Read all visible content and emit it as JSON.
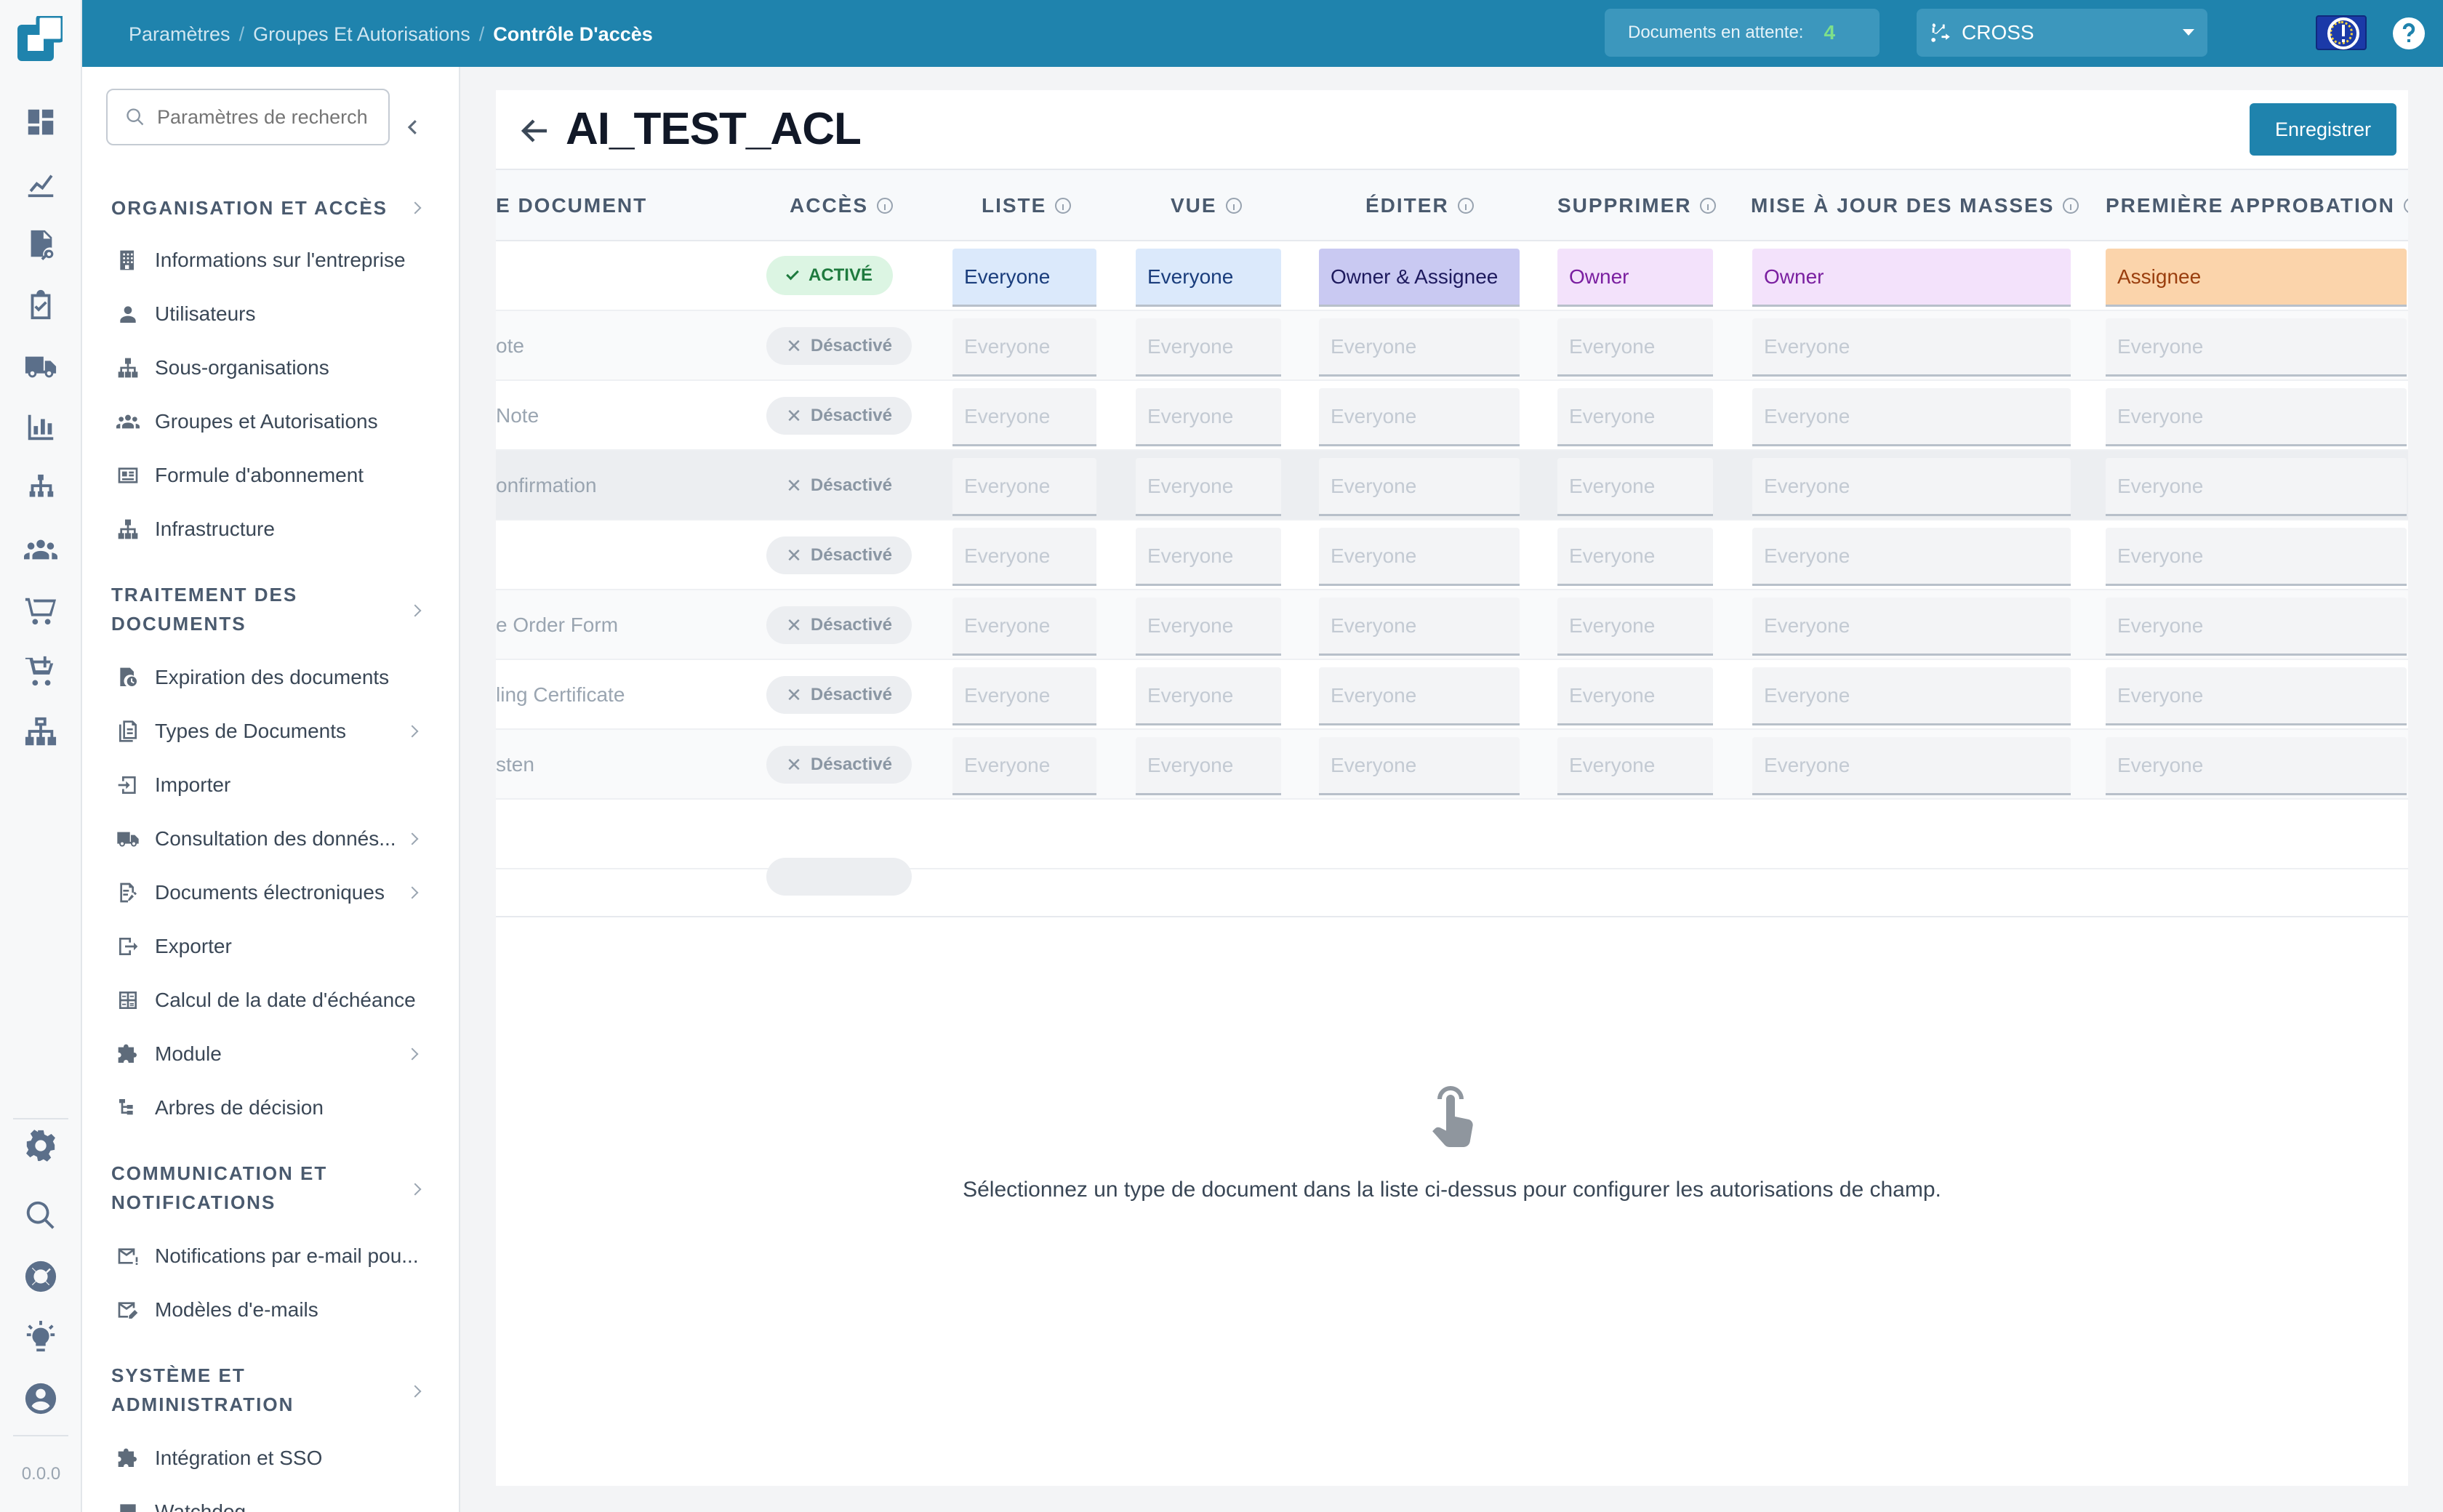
{
  "app": {
    "version": "0.0.0"
  },
  "breadcrumb": [
    "Paramètres",
    "Groupes Et Autorisations",
    "Contrôle D'accès"
  ],
  "header": {
    "pending_label": "Documents en attente:",
    "pending_count": "4",
    "org_select": "CROSS"
  },
  "sidebar": {
    "search_placeholder": "Paramètres de recherche",
    "sections": [
      {
        "title": "ORGANISATION ET ACCÈS",
        "items": [
          {
            "label": "Informations sur l'entreprise",
            "icon": "building-icon"
          },
          {
            "label": "Utilisateurs",
            "icon": "user-icon"
          },
          {
            "label": "Sous-organisations",
            "icon": "hierarchy-icon"
          },
          {
            "label": "Groupes et Autorisations",
            "icon": "group-icon"
          },
          {
            "label": "Formule d'abonnement",
            "icon": "card-icon"
          },
          {
            "label": "Infrastructure",
            "icon": "hierarchy-icon"
          }
        ]
      },
      {
        "title": "TRAITEMENT DES DOCUMENTS",
        "items": [
          {
            "label": "Expiration des documents",
            "icon": "doc-clock-icon"
          },
          {
            "label": "Types de Documents",
            "icon": "docs-icon"
          },
          {
            "label": "Importer",
            "icon": "import-icon"
          },
          {
            "label": "Consultation des donnés...",
            "icon": "truck-icon"
          },
          {
            "label": "Documents électroniques",
            "icon": "edoc-icon"
          },
          {
            "label": "Exporter",
            "icon": "export-icon"
          },
          {
            "label": "Calcul de la date d'échéance",
            "icon": "calculator-icon"
          },
          {
            "label": "Module",
            "icon": "puzzle-icon"
          },
          {
            "label": "Arbres de décision",
            "icon": "tree-icon"
          }
        ]
      },
      {
        "title": "COMMUNICATION ET NOTIFICATIONS",
        "items": [
          {
            "label": "Notifications par e-mail pou...",
            "icon": "mail-alert-icon"
          },
          {
            "label": "Modèles d'e-mails",
            "icon": "mail-template-icon"
          }
        ]
      },
      {
        "title": "SYSTÈME ET ADMINISTRATION",
        "items": [
          {
            "label": "Intégration et SSO",
            "icon": "puzzle-icon"
          },
          {
            "label": "Watchdog",
            "icon": "watchdog-icon"
          }
        ]
      }
    ]
  },
  "page": {
    "title": "AI_TEST_ACL",
    "save_label": "Enregistrer"
  },
  "table": {
    "columns": [
      "E DOCUMENT",
      "ACCÈS",
      "LISTE",
      "VUE",
      "ÉDITER",
      "SUPPRIMER",
      "MISE À JOUR DES MASSES",
      "PREMIÈRE APPROBATION"
    ],
    "rows": [
      {
        "name": "",
        "access": "ACTIVÉ",
        "liste": "Everyone",
        "vue": "Everyone",
        "editer": "Owner & Assignee",
        "supprimer": "Owner",
        "mise": "Owner",
        "premiere": "Assignee"
      },
      {
        "name": "ote",
        "access": "Désactivé",
        "liste": "Everyone",
        "vue": "Everyone",
        "editer": "Everyone",
        "supprimer": "Everyone",
        "mise": "Everyone",
        "premiere": "Everyone"
      },
      {
        "name": "Note",
        "access": "Désactivé",
        "liste": "Everyone",
        "vue": "Everyone",
        "editer": "Everyone",
        "supprimer": "Everyone",
        "mise": "Everyone",
        "premiere": "Everyone"
      },
      {
        "name": "onfirmation",
        "access": "Désactivé",
        "liste": "Everyone",
        "vue": "Everyone",
        "editer": "Everyone",
        "supprimer": "Everyone",
        "mise": "Everyone",
        "premiere": "Everyone"
      },
      {
        "name": "",
        "access": "Désactivé",
        "liste": "Everyone",
        "vue": "Everyone",
        "editer": "Everyone",
        "supprimer": "Everyone",
        "mise": "Everyone",
        "premiere": "Everyone"
      },
      {
        "name": "e Order Form",
        "access": "Désactivé",
        "liste": "Everyone",
        "vue": "Everyone",
        "editer": "Everyone",
        "supprimer": "Everyone",
        "mise": "Everyone",
        "premiere": "Everyone"
      },
      {
        "name": "ling Certificate",
        "access": "Désactivé",
        "liste": "Everyone",
        "vue": "Everyone",
        "editer": "Everyone",
        "supprimer": "Everyone",
        "mise": "Everyone",
        "premiere": "Everyone"
      },
      {
        "name": "sten",
        "access": "Désactivé",
        "liste": "Everyone",
        "vue": "Everyone",
        "editer": "Everyone",
        "supprimer": "Everyone",
        "mise": "Everyone",
        "premiere": "Everyone"
      }
    ]
  },
  "empty_state": {
    "message": "Sélectionnez un type de document dans la liste ci-dessus pour configurer les autorisations de champ.",
    "icon": "tap-hand-icon"
  },
  "colors": {
    "brand": "#1f83ad",
    "active_green": "#1e7a3e",
    "everyone_bg": "#dbe9fb",
    "owner_assignee_bg": "#c9c9f2",
    "owner_bg": "#f3e2fb",
    "assignee_bg": "#fbd4ab"
  }
}
